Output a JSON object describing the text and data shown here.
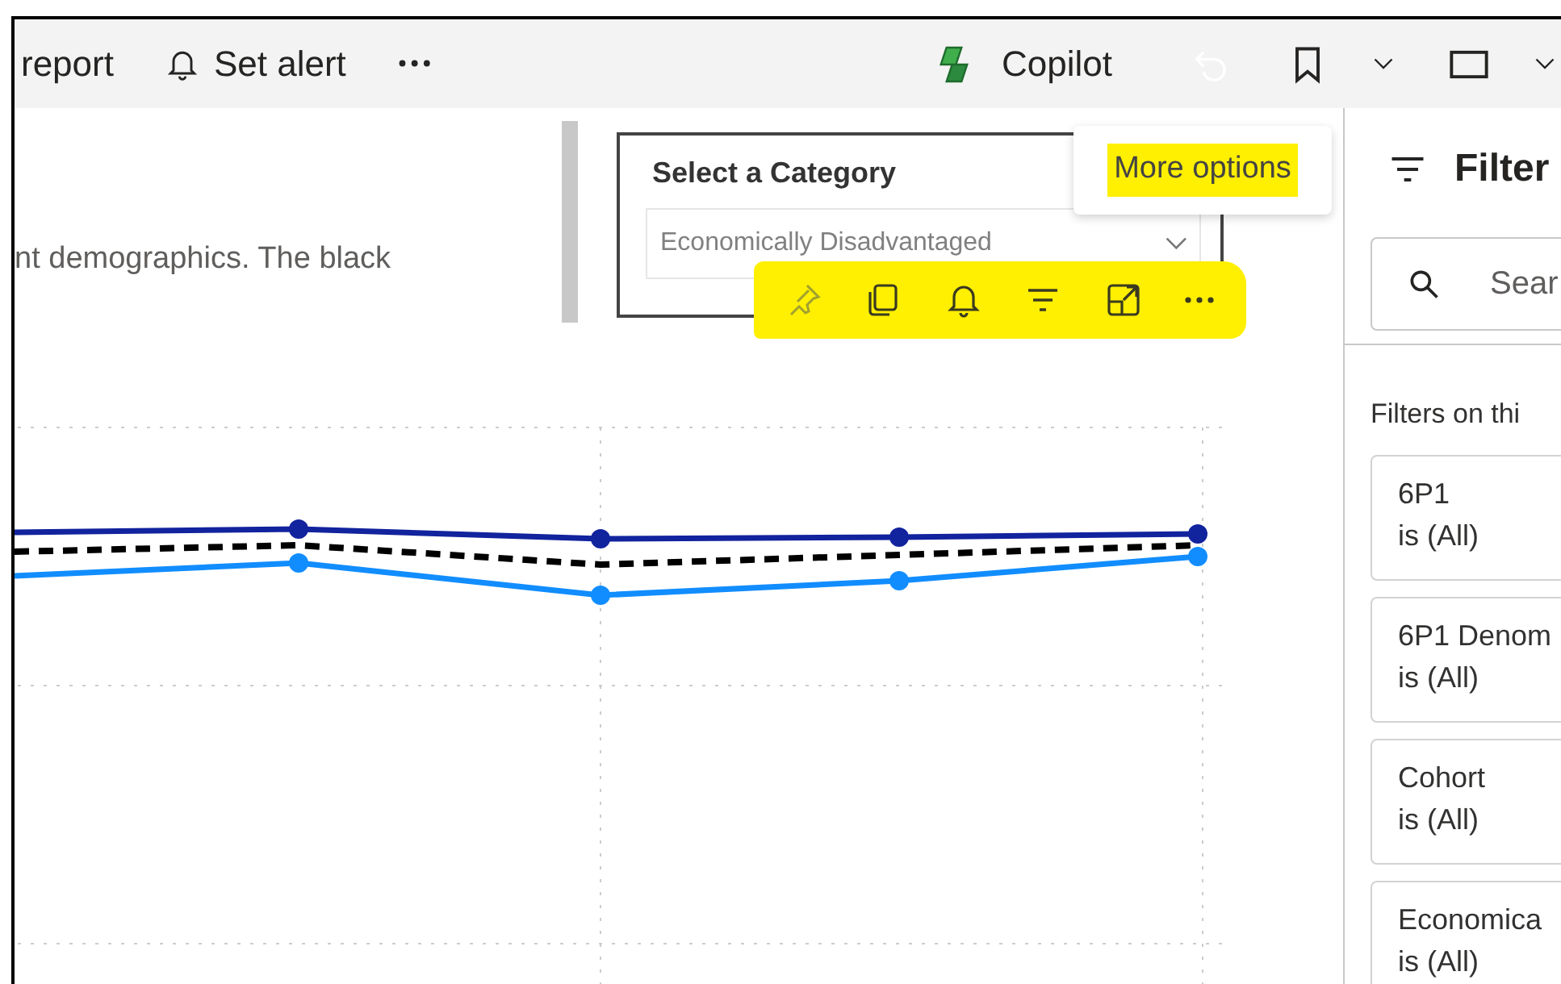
{
  "toolbar": {
    "items": [
      {
        "kind": "text",
        "label": "report"
      },
      {
        "kind": "alert",
        "label": "Set alert"
      },
      {
        "kind": "more"
      }
    ],
    "copilot": {
      "label": "Copilot"
    },
    "right_icons": [
      {
        "kind": "undo",
        "disabled": true
      },
      {
        "kind": "bookmark",
        "disabled": false,
        "dropdown": true
      },
      {
        "kind": "view",
        "disabled": false,
        "dropdown": true
      }
    ]
  },
  "canvas": {
    "description": "nt demographics. The black",
    "slicer": {
      "title": "Select a Category",
      "value": "Economically Disadvantaged"
    },
    "visual_header": {
      "highlighted": true,
      "icons": [
        {
          "kind": "pin",
          "disabled": true
        },
        {
          "kind": "copy",
          "disabled": false
        },
        {
          "kind": "alert",
          "disabled": false
        },
        {
          "kind": "filter",
          "disabled": false
        },
        {
          "kind": "focus",
          "disabled": false
        },
        {
          "kind": "more",
          "disabled": false
        }
      ]
    },
    "tooltip": {
      "text": "More options",
      "highlighted": true
    }
  },
  "filter_pane": {
    "title": "Filter",
    "search": {
      "placeholder": "Sear"
    },
    "section": "Filters on thi",
    "cards": [
      {
        "name": "6P1",
        "state": "is (All)"
      },
      {
        "name": "6P1 Denom",
        "state": "is (All)"
      },
      {
        "name": "Cohort",
        "state": "is (All)"
      },
      {
        "name": "Economica",
        "state": "is (All)"
      }
    ]
  }
}
